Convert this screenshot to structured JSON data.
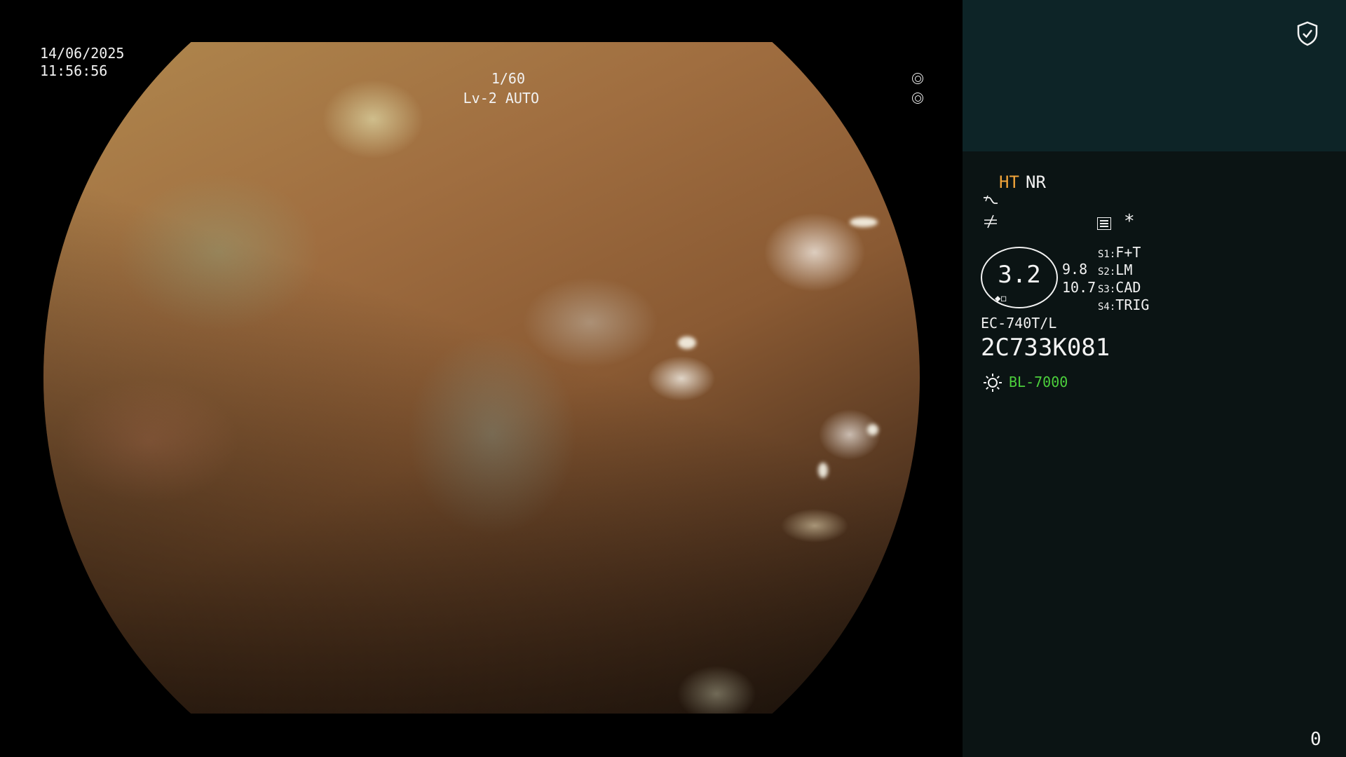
{
  "video": {
    "date": "14/06/2025",
    "time": "11:56:56",
    "shutter": "1/60",
    "level": "Lv-2 AUTO"
  },
  "panel": {
    "mode_ht": "HT",
    "mode_nr": "NR",
    "asterisk": "*",
    "zoom_value": "3.2",
    "readout_a": "9.8",
    "readout_b": "10.7",
    "switches": [
      {
        "key": "S1:",
        "value": "F+T"
      },
      {
        "key": "S2:",
        "value": "LM"
      },
      {
        "key": "S3:",
        "value": "CAD"
      },
      {
        "key": "S4:",
        "value": "TRIG"
      }
    ],
    "scope_model": "EC-740T/L",
    "scope_serial": "2C733K081",
    "light_source": "BL-7000",
    "counter": "0"
  },
  "colors": {
    "accent_orange": "#f0a43a",
    "light_green": "#4ccf3c",
    "panel_top": "#0d2427",
    "panel_bg": "#0b1414"
  },
  "icons": {
    "top_right": "shield-check-icon",
    "shutter": "aperture-icon",
    "level": "iris-icon",
    "curve": "curve-icon",
    "noeq": "not-equal-icon",
    "list": "list-icon",
    "light": "sun-icon"
  }
}
